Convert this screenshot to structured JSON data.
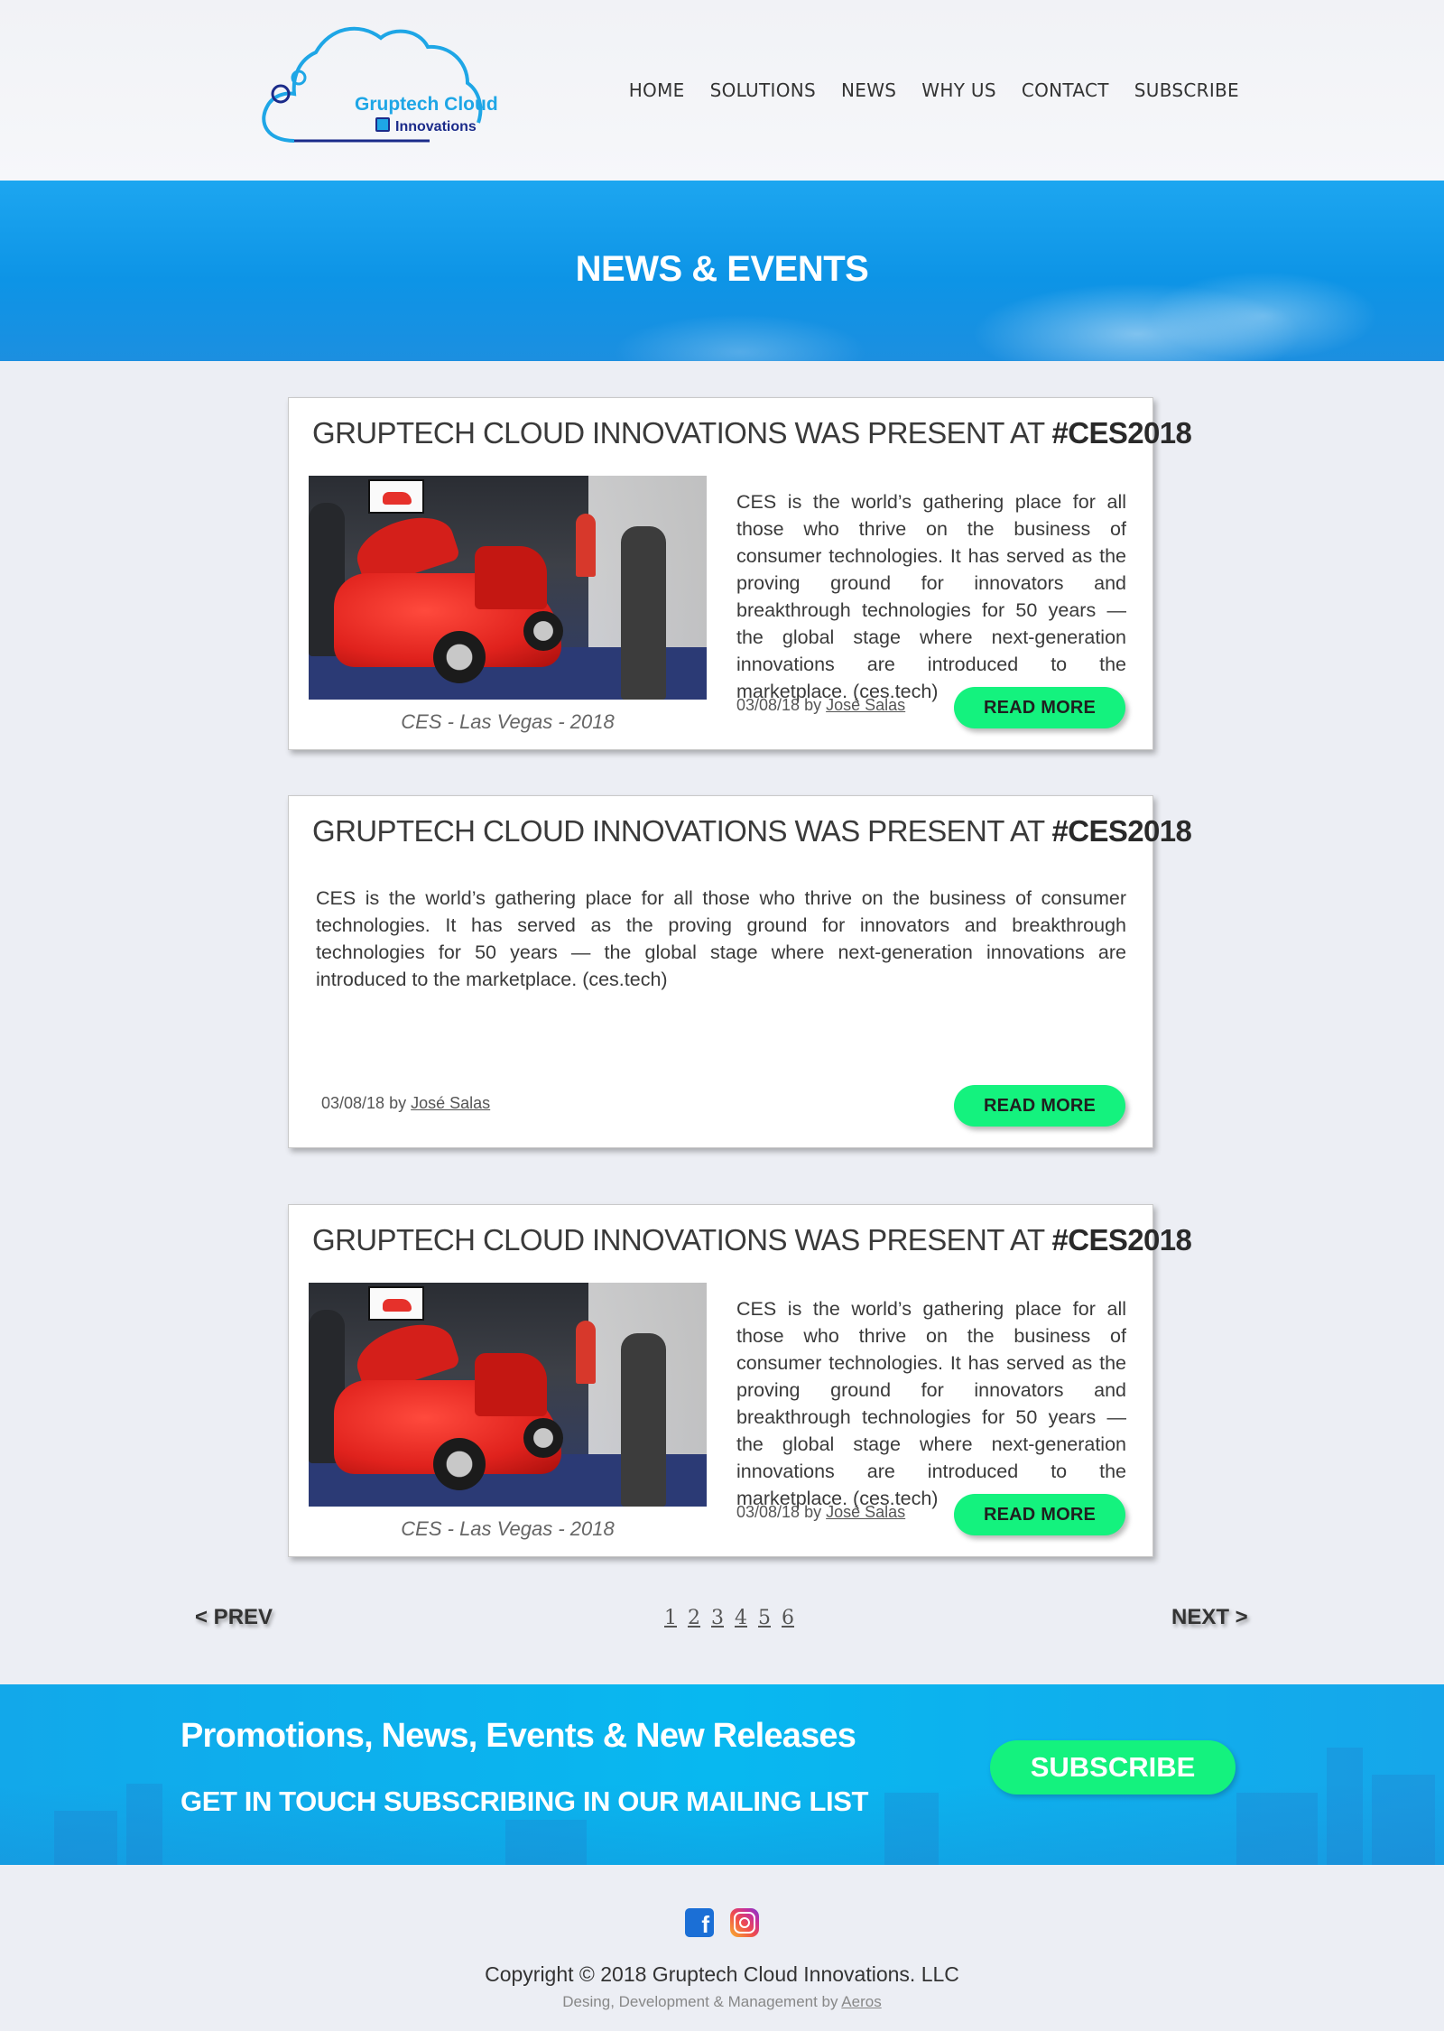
{
  "header": {
    "logo": {
      "line1": "Gruptech Cloud",
      "line2": "Innovations"
    },
    "nav": [
      "HOME",
      "SOLUTIONS",
      "NEWS",
      "WHY US",
      "CONTACT",
      "SUBSCRIBE"
    ]
  },
  "hero": {
    "title": "NEWS & EVENTS"
  },
  "posts": [
    {
      "title_prefix": "GRUPTECH CLOUD INNOVATIONS WAS PRESENT AT ",
      "title_tag": "#CES2018",
      "has_image": true,
      "caption": "CES - Las Vegas - 2018",
      "excerpt": "CES is the world’s gathering place for all those who thrive on the business of consumer technologies. It has served as the proving ground for innovators and breakthrough technologies for 50 years — the global stage where next-generation innovations are introduced to the marketplace. (ces.tech)",
      "date": "03/08/18",
      "by": "by",
      "author": "José Salas",
      "read_more": "READ MORE"
    },
    {
      "title_prefix": "GRUPTECH CLOUD INNOVATIONS WAS PRESENT AT ",
      "title_tag": "#CES2018",
      "has_image": false,
      "excerpt": "CES is the world’s gathering place for all those who thrive on the business of consumer technologies. It has served as the proving ground for innovators and breakthrough technologies for 50 years — the global stage where next-generation innovations are introduced to the marketplace. (ces.tech)",
      "date": "03/08/18",
      "by": "by",
      "author": "José Salas",
      "read_more": "READ MORE"
    },
    {
      "title_prefix": "GRUPTECH CLOUD INNOVATIONS WAS PRESENT AT ",
      "title_tag": "#CES2018",
      "has_image": true,
      "caption": "CES - Las Vegas - 2018",
      "excerpt": "CES is the world’s gathering place for all those who thrive on the business of consumer technologies. It has served as the proving ground for innovators and breakthrough technologies for 50 years — the global stage where next-generation innovations are introduced to the marketplace. (ces.tech)",
      "date": "03/08/18",
      "by": "by",
      "author": "José Salas",
      "read_more": "READ MORE"
    }
  ],
  "pagination": {
    "prev": "< PREV",
    "next": "NEXT >",
    "pages": [
      "1",
      "2",
      "3",
      "4",
      "5",
      "6"
    ]
  },
  "banner": {
    "headline": "Promotions, News, Events & New Releases",
    "subline": "GET IN TOUCH SUBSCRIBING IN OUR MAILING LIST",
    "button": "SUBSCRIBE"
  },
  "footer": {
    "social": [
      "facebook-icon",
      "instagram-icon"
    ],
    "copyright": "Copyright © 2018 Gruptech Cloud Innovations. LLC",
    "credits_prefix": "Desing, Development & Management by ",
    "credits_link": "Aeros"
  },
  "colors": {
    "accent_green": "#14f27e",
    "hero_blue": "#0d94e6",
    "banner_blue": "#08b8f0",
    "logo_blue": "#1ea6e6",
    "logo_navy": "#1b2b8a"
  }
}
